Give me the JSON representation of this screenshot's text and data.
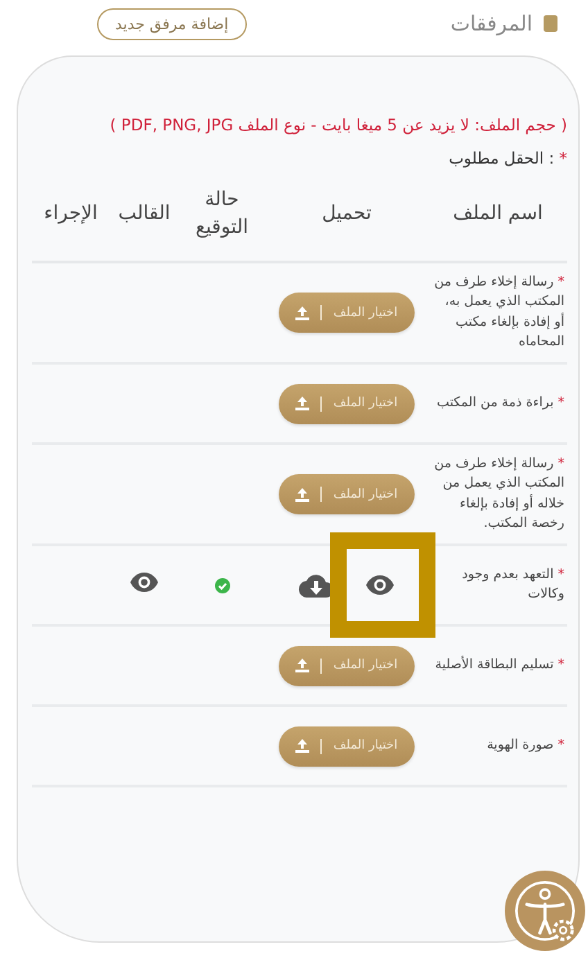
{
  "header": {
    "title": "المرفقات",
    "add_button": "إضافة مرفق جديد"
  },
  "notes": {
    "file_limits": "( حجم الملف: لا يزيد عن 5 ميغا بايت - نوع الملف PDF, PNG, JPG )",
    "required_mark": "*",
    "required_text": ": الحقل مطلوب"
  },
  "table": {
    "columns": [
      "اسم الملف",
      "تحميل",
      "حالة التوقيع",
      "القالب",
      "الإجراء"
    ],
    "rows": [
      {
        "kind": "upload",
        "required_mark": "*",
        "name": "رسالة إخلاء طرف من المكتب الذي يعمل به، أو إفادة بإلغاء مكتب المحاماه",
        "button": "اختيار الملف",
        "signed": false
      },
      {
        "kind": "upload",
        "required_mark": "*",
        "name": "براءة ذمة من المكتب",
        "button": "اختيار الملف",
        "signed": false
      },
      {
        "kind": "upload",
        "required_mark": "*",
        "name": "رسالة إخلاء طرف من المكتب الذي يعمل من خلاله أو إفادة بإلغاء رخصة المكتب.",
        "button": "اختيار الملف",
        "signed": false
      },
      {
        "kind": "template",
        "required_mark": "*",
        "name": "التعهد بعدم وجود وكالات",
        "signed": true,
        "highlight": true
      },
      {
        "kind": "upload",
        "required_mark": "*",
        "name": "تسليم البطاقة الأصلية",
        "button": "اختيار الملف",
        "signed": false
      },
      {
        "kind": "upload",
        "required_mark": "*",
        "name": "صورة الهوية",
        "button": "اختيار الملف",
        "signed": false
      }
    ]
  }
}
